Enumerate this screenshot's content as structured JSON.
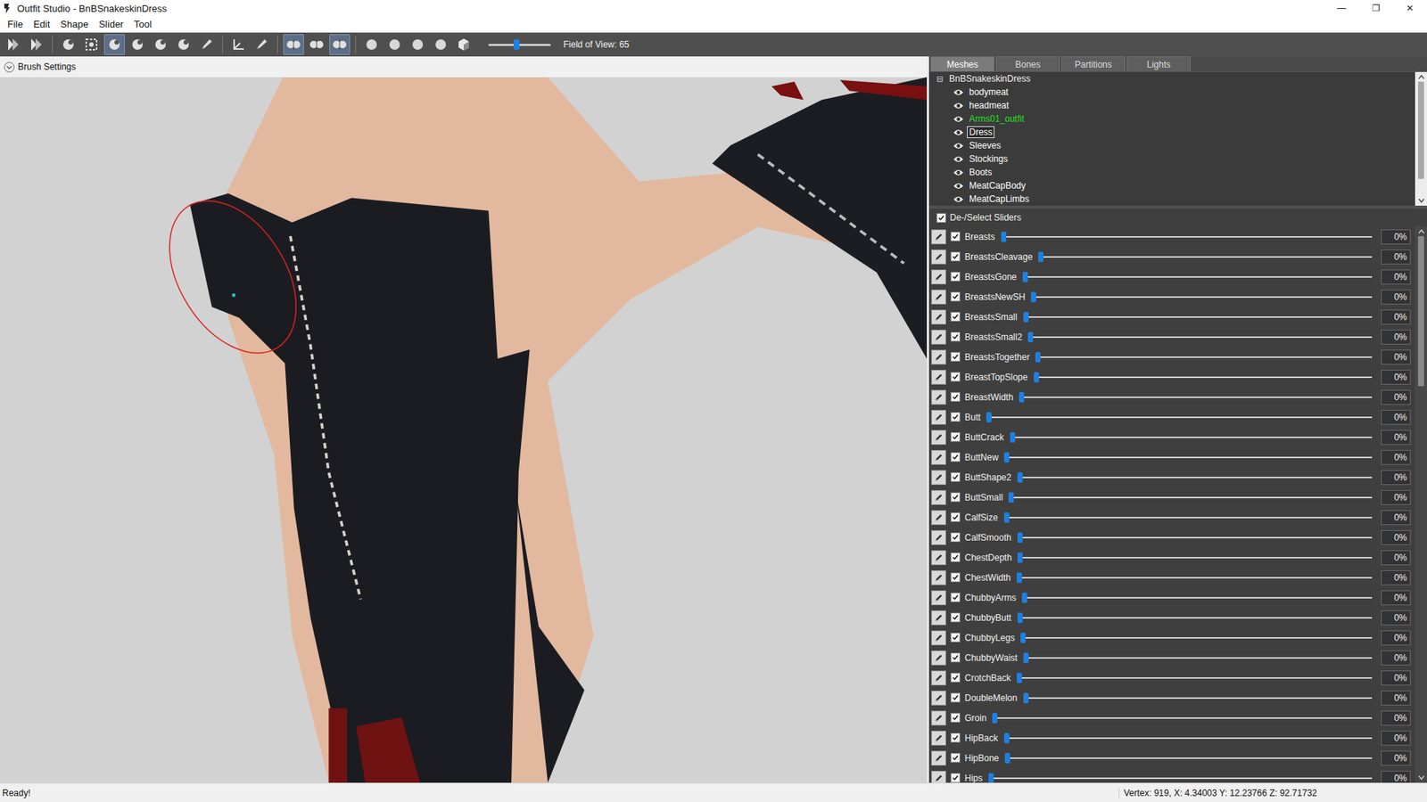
{
  "window": {
    "title": "Outfit Studio - BnBSnakeskinDress",
    "controls": [
      "—",
      "❐",
      "✕"
    ]
  },
  "menu": [
    "File",
    "Edit",
    "Shape",
    "Slider",
    "Tool"
  ],
  "toolbar": {
    "tools": [
      {
        "kind": "forward",
        "selected": false
      },
      {
        "kind": "forward",
        "selected": false
      },
      {
        "kind": "separator",
        "selected": false
      },
      {
        "kind": "brush",
        "selected": false
      },
      {
        "kind": "box",
        "selected": false
      },
      {
        "kind": "brush",
        "selected": true
      },
      {
        "kind": "brush",
        "selected": false
      },
      {
        "kind": "brush",
        "selected": false
      },
      {
        "kind": "brush",
        "selected": false
      },
      {
        "kind": "pen",
        "selected": false
      },
      {
        "kind": "separator",
        "selected": false
      },
      {
        "kind": "axes",
        "selected": false
      },
      {
        "kind": "pen",
        "selected": false
      },
      {
        "kind": "separator",
        "selected": false
      },
      {
        "kind": "mirror",
        "selected": true
      },
      {
        "kind": "mirror",
        "selected": false
      },
      {
        "kind": "mirror",
        "selected": true
      },
      {
        "kind": "separator",
        "selected": false
      },
      {
        "kind": "dot",
        "selected": false
      },
      {
        "kind": "dot",
        "selected": false
      },
      {
        "kind": "dot",
        "selected": false
      },
      {
        "kind": "dot",
        "selected": false
      },
      {
        "kind": "cube",
        "selected": false
      }
    ],
    "fov": {
      "level": 0.45,
      "label": "Field of View: 65"
    }
  },
  "brush_settings": {
    "label": "Brush Settings",
    "expanded": false
  },
  "tabs": [
    {
      "label": "Meshes",
      "selected": true
    },
    {
      "label": "Bones",
      "selected": false
    },
    {
      "label": "Partitions",
      "selected": false
    },
    {
      "label": "Lights",
      "selected": false
    }
  ],
  "mesh_tree": {
    "root": {
      "label": "BnBSnakeskinDress",
      "toggle": "⊟",
      "expanded": true
    },
    "items": [
      {
        "label": "bodymeat",
        "selected": false,
        "color": "#ffffff"
      },
      {
        "label": "headmeat",
        "selected": false,
        "color": "#ffffff"
      },
      {
        "label": "Arms01_outfit",
        "selected": false,
        "color": "#22e022"
      },
      {
        "label": "Dress",
        "selected": true,
        "color": "#ffffff"
      },
      {
        "label": "Sleeves",
        "selected": false,
        "color": "#ffffff"
      },
      {
        "label": "Stockings",
        "selected": false,
        "color": "#ffffff"
      },
      {
        "label": "Boots",
        "selected": false,
        "color": "#ffffff"
      },
      {
        "label": "MeatCapBody",
        "selected": false,
        "color": "#ffffff"
      },
      {
        "label": "MeatCapLimbs",
        "selected": false,
        "color": "#ffffff"
      }
    ]
  },
  "select_all": {
    "label": "De-/Select Sliders",
    "checked": true
  },
  "sliders": [
    {
      "name": "Breasts",
      "checked": true,
      "level": 0,
      "reading": "0%"
    },
    {
      "name": "BreastsCleavage",
      "checked": true,
      "level": 0,
      "reading": "0%"
    },
    {
      "name": "BreastsGone",
      "checked": true,
      "level": 0,
      "reading": "0%"
    },
    {
      "name": "BreastsNewSH",
      "checked": true,
      "level": 0,
      "reading": "0%"
    },
    {
      "name": "BreastsSmall",
      "checked": true,
      "level": 0,
      "reading": "0%"
    },
    {
      "name": "BreastsSmall2",
      "checked": true,
      "level": 0,
      "reading": "0%"
    },
    {
      "name": "BreastsTogether",
      "checked": true,
      "level": 0,
      "reading": "0%"
    },
    {
      "name": "BreastTopSlope",
      "checked": true,
      "level": 0,
      "reading": "0%"
    },
    {
      "name": "BreastWidth",
      "checked": true,
      "level": 0,
      "reading": "0%"
    },
    {
      "name": "Butt",
      "checked": true,
      "level": 0,
      "reading": "0%"
    },
    {
      "name": "ButtCrack",
      "checked": true,
      "level": 0,
      "reading": "0%"
    },
    {
      "name": "ButtNew",
      "checked": true,
      "level": 0,
      "reading": "0%"
    },
    {
      "name": "ButtShape2",
      "checked": true,
      "level": 0,
      "reading": "0%"
    },
    {
      "name": "ButtSmall",
      "checked": true,
      "level": 0,
      "reading": "0%"
    },
    {
      "name": "CalfSize",
      "checked": true,
      "level": 0,
      "reading": "0%"
    },
    {
      "name": "CalfSmooth",
      "checked": true,
      "level": 0,
      "reading": "0%"
    },
    {
      "name": "ChestDepth",
      "checked": true,
      "level": 0,
      "reading": "0%"
    },
    {
      "name": "ChestWidth",
      "checked": true,
      "level": 0,
      "reading": "0%"
    },
    {
      "name": "ChubbyArms",
      "checked": true,
      "level": 0,
      "reading": "0%"
    },
    {
      "name": "ChubbyButt",
      "checked": true,
      "level": 0,
      "reading": "0%"
    },
    {
      "name": "ChubbyLegs",
      "checked": true,
      "level": 0,
      "reading": "0%"
    },
    {
      "name": "ChubbyWaist",
      "checked": true,
      "level": 0,
      "reading": "0%"
    },
    {
      "name": "CrotchBack",
      "checked": true,
      "level": 0,
      "reading": "0%"
    },
    {
      "name": "DoubleMelon",
      "checked": true,
      "level": 0,
      "reading": "0%"
    },
    {
      "name": "Groin",
      "checked": true,
      "level": 0,
      "reading": "0%"
    },
    {
      "name": "HipBack",
      "checked": true,
      "level": 0,
      "reading": "0%"
    },
    {
      "name": "HipBone",
      "checked": true,
      "level": 0,
      "reading": "0%"
    },
    {
      "name": "Hips",
      "checked": true,
      "level": 0,
      "reading": "0%"
    }
  ],
  "status_bar": {
    "message": "Ready!",
    "vertex": "Vertex: 919, X: 4.34003 Y: 12.23766 Z: 92.71732"
  }
}
